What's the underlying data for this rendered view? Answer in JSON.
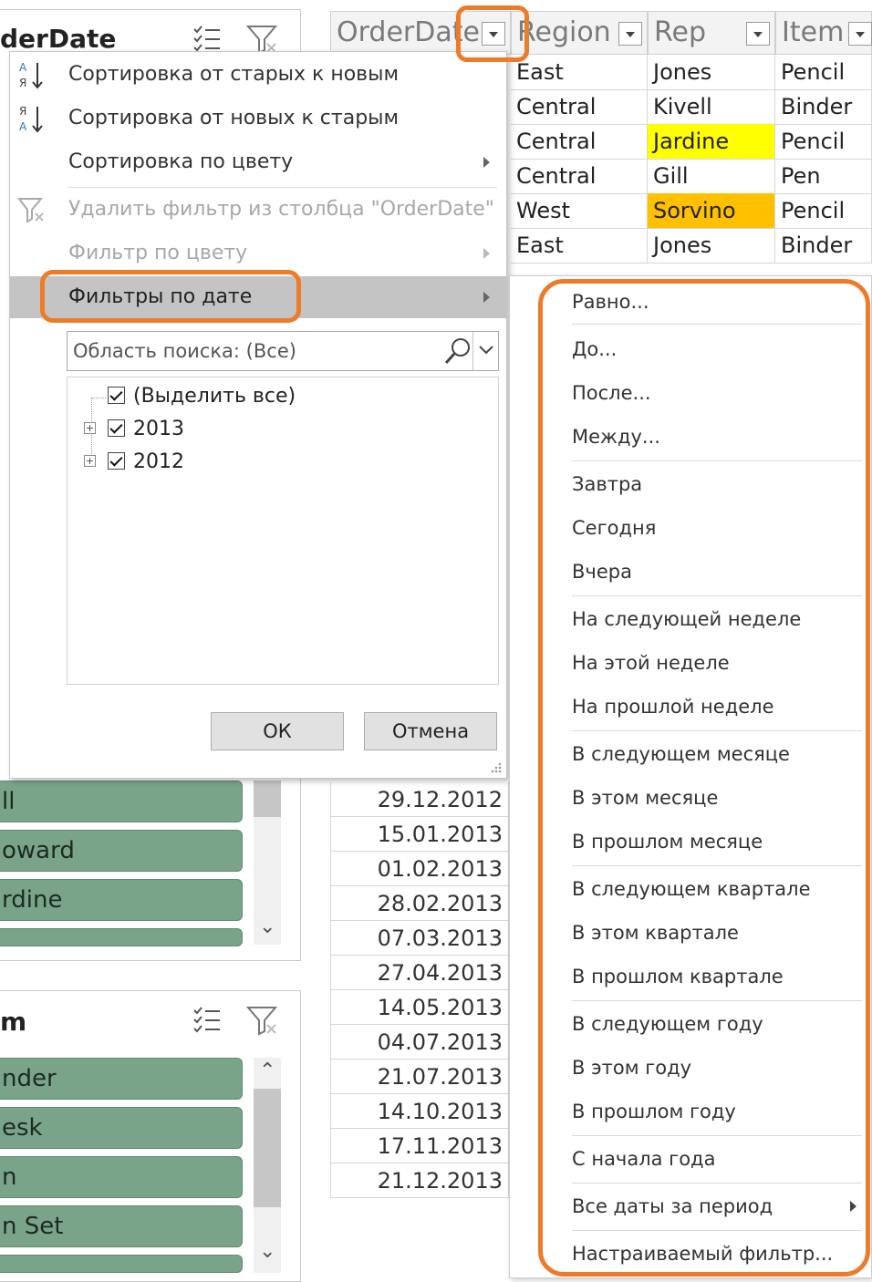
{
  "colors": {
    "highlight_orange": "#ec7b2a",
    "slicer_green": "#7aa48a",
    "yellow_cell": "#ffff00",
    "orange_cell": "#ffc000"
  },
  "slicer_top": {
    "title": "derDate",
    "items": [
      "ll",
      "oward",
      "rdine"
    ]
  },
  "slicer_bottom": {
    "title": "m",
    "items": [
      "nder",
      "esk",
      "n",
      "n Set"
    ]
  },
  "headers": {
    "orderdate": "OrderDate",
    "region": "Region",
    "rep": "Rep",
    "item": "Item"
  },
  "grid_rows": [
    {
      "region": "East",
      "rep": "Jones",
      "item": "Pencil"
    },
    {
      "region": "Central",
      "rep": "Kivell",
      "item": "Binder"
    },
    {
      "region": "Central",
      "rep": "Jardine",
      "item": "Pencil"
    },
    {
      "region": "Central",
      "rep": "Gill",
      "item": "Pen"
    },
    {
      "region": "West",
      "rep": "Sorvino",
      "item": "Pencil"
    },
    {
      "region": "East",
      "rep": "Jones",
      "item": "Binder"
    }
  ],
  "dates": [
    "29.12.2012",
    "15.01.2013",
    "01.02.2013",
    "28.02.2013",
    "07.03.2013",
    "27.04.2013",
    "14.05.2013",
    "04.07.2013",
    "21.07.2013",
    "14.10.2013",
    "17.11.2013",
    "21.12.2013"
  ],
  "filter_menu": {
    "sort_asc": "Сортировка от старых к новым",
    "sort_desc": "Сортировка от новых к старым",
    "sort_color": "Сортировка по цвету",
    "clear_filter": "Удалить фильтр из столбца \"OrderDate\"",
    "filter_color": "Фильтр по цвету",
    "date_filters": "Фильтры по дате",
    "search_placeholder": "Область поиска: (Все)",
    "tree": [
      "(Выделить все)",
      "2013",
      "2012"
    ],
    "ok": "ОК",
    "cancel": "Отмена"
  },
  "date_submenu": [
    "Равно...",
    "До...",
    "После...",
    "Между...",
    "Завтра",
    "Сегодня",
    "Вчера",
    "На следующей неделе",
    "На этой неделе",
    "На прошлой неделе",
    "В следующем месяце",
    "В этом месяце",
    "В прошлом месяце",
    "В следующем квартале",
    "В этом квартале",
    "В прошлом квартале",
    "В следующем году",
    "В этом году",
    "В прошлом году",
    "С начала года",
    "Все даты за период",
    "Настраиваемый фильтр..."
  ]
}
